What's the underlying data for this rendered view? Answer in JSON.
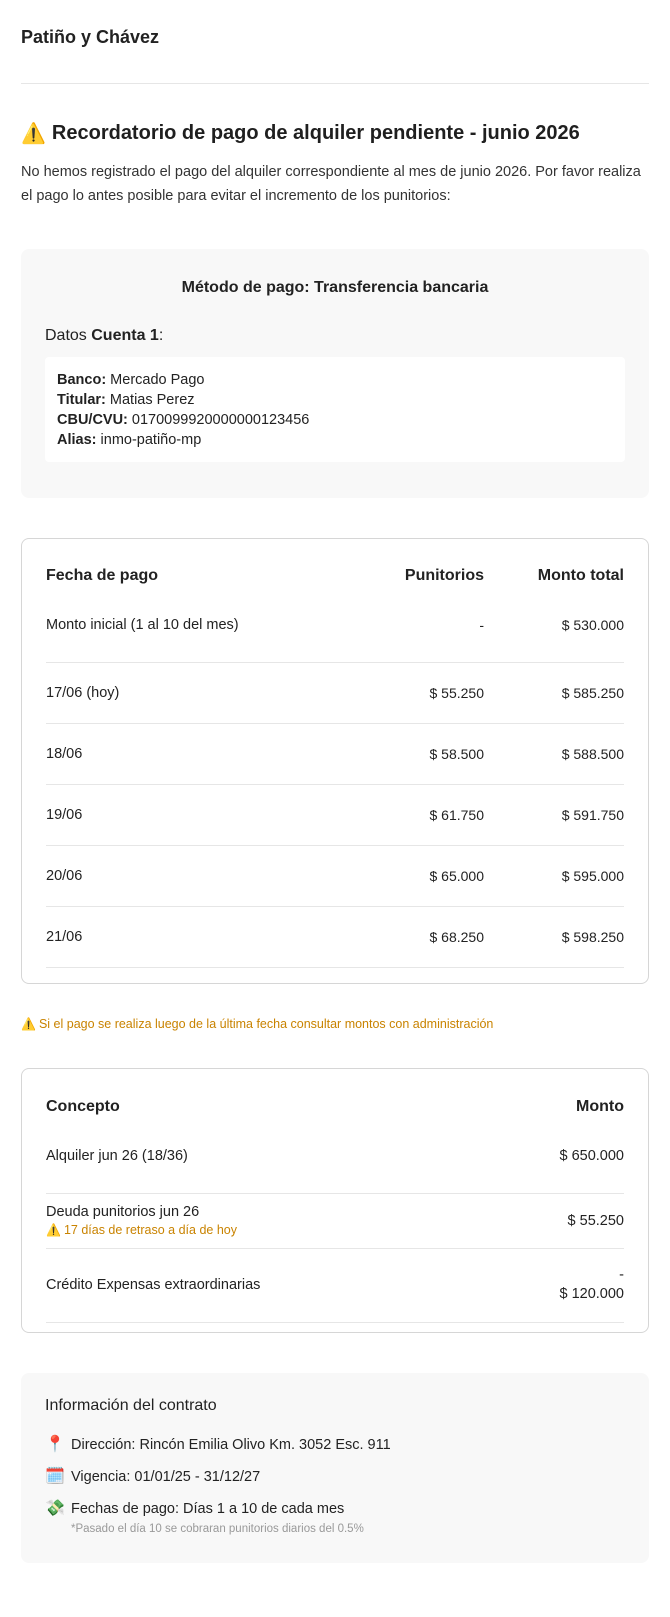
{
  "brand": "Patiño y Chávez",
  "title": "Recordatorio de pago de alquiler pendiente - junio 2026",
  "title_icon": "⚠️",
  "intro": "No hemos registrado el pago del alquiler correspondiente al mes de junio 2026. Por favor realiza el pago lo antes posible para evitar el incremento de los punitorios:",
  "payment": {
    "method": "Método de pago: Transferencia bancaria",
    "account_prefix": "Datos ",
    "account_name": "Cuenta 1",
    "account_suffix": ":",
    "fields": [
      {
        "label": "Banco:",
        "value": " Mercado Pago"
      },
      {
        "label": "Titular:",
        "value": " Matias Perez"
      },
      {
        "label": "CBU/CVU:",
        "value": " 0170099920000000123456"
      },
      {
        "label": "Alias:",
        "value": " inmo-patiño-mp"
      }
    ]
  },
  "fees": {
    "headers": [
      "Fecha de pago",
      "Punitorios",
      "Monto total"
    ],
    "rows": [
      {
        "date": "Monto inicial (1 al 10 del mes)",
        "penalty": "-",
        "total": "$ 530.000"
      },
      {
        "date": "17/06 (hoy)",
        "penalty": "$ 55.250",
        "total": "$ 585.250"
      },
      {
        "date": "18/06",
        "penalty": "$ 58.500",
        "total": "$ 588.500"
      },
      {
        "date": "19/06",
        "penalty": "$ 61.750",
        "total": "$ 591.750"
      },
      {
        "date": "20/06",
        "penalty": "$ 65.000",
        "total": "$ 595.000"
      },
      {
        "date": "21/06",
        "penalty": "$ 68.250",
        "total": "$ 598.250"
      }
    ]
  },
  "notice": "Si el pago se realiza luego de la última fecha consultar montos con administración",
  "notice_icon": "⚠️",
  "concepts": {
    "headers": [
      "Concepto",
      "Monto"
    ],
    "rows": [
      {
        "concept": "Alquiler jun 26 (18/36)",
        "amount": "$ 650.000"
      },
      {
        "concept": "Deuda punitorios jun 26",
        "note": "17 días de retraso a día de hoy",
        "amount": "$ 55.250"
      },
      {
        "concept": "Crédito Expensas extraordinarias",
        "sign": "-",
        "amount": "$ 120.000"
      }
    ]
  },
  "contract": {
    "title": "Información del contrato",
    "items": [
      {
        "icon": "📍",
        "text": "Dirección: Rincón Emilia Olivo Km. 3052 Esc. 911"
      },
      {
        "icon": "🗓️",
        "text": "Vigencia: 01/01/25 - 31/12/27"
      },
      {
        "icon": "💸",
        "text": "Fechas de pago: Días 1 a 10 de cada mes",
        "note": "*Pasado el día 10 se cobraran punitorios diarios del 0.5%"
      }
    ]
  }
}
